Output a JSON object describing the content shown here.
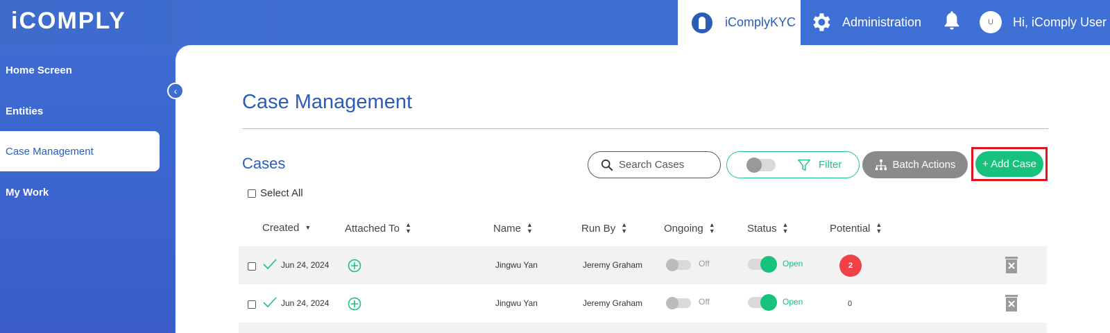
{
  "header": {
    "logo": "iCOMPLY",
    "app_tab": "iComplyKYC",
    "admin": "Administration",
    "avatar_initial": "U",
    "greeting": "Hi, iComply User"
  },
  "sidebar": {
    "items": [
      {
        "label": "Home Screen"
      },
      {
        "label": "Entities"
      },
      {
        "label": "Case Management"
      },
      {
        "label": "My Work"
      }
    ],
    "collapse_glyph": "‹"
  },
  "main": {
    "page_title": "Case Management",
    "section_title": "Cases",
    "search_placeholder": "Search Cases",
    "filter_label": "Filter",
    "batch_label": "Batch Actions",
    "add_label": "+ Add Case",
    "select_all": "Select All",
    "columns": [
      "Created",
      "Attached To",
      "Name",
      "Run By",
      "Ongoing",
      "Status",
      "Potential"
    ],
    "rows": [
      {
        "created": "Jun 24, 2024",
        "name": "Jingwu Yan",
        "run_by": "Jeremy Graham",
        "ongoing": "Off",
        "status": "Open",
        "potential": "2"
      },
      {
        "created": "Jun 24, 2024",
        "name": "Jingwu Yan",
        "run_by": "Jeremy Graham",
        "ongoing": "Off",
        "status": "Open",
        "potential": "0"
      }
    ]
  },
  "colors": {
    "brand_blue": "#3e6cd2",
    "accent_green": "#16c27c",
    "alert_red": "#f04048",
    "highlight_box": "#e0141c"
  }
}
